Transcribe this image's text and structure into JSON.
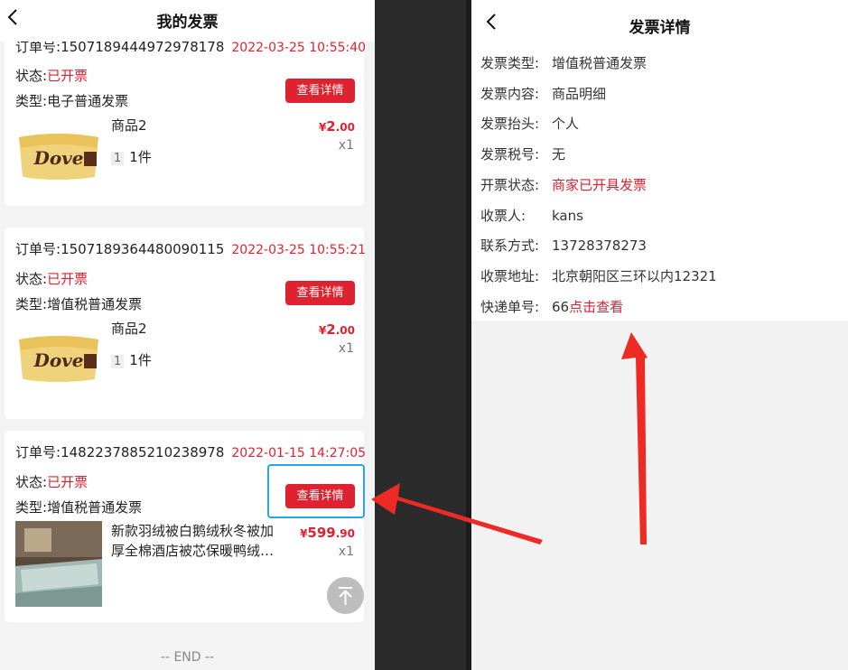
{
  "left": {
    "title": "我的发票",
    "back_glyph": "<",
    "orders": [
      {
        "order_label": "订单号:",
        "order_no": "1507189444972978178",
        "datetime": "2022-03-25 10:55:40",
        "status_label": "状态:",
        "status_value": "已开票",
        "type_label": "类型:",
        "type_value": "电子普通发票",
        "button": "查看详情",
        "product_name": "商品2",
        "qty_badge": "1",
        "qty_text": "1件",
        "price_symbol": "¥",
        "price_int": "2",
        "price_dec": ".00",
        "count": "x1"
      },
      {
        "order_label": "订单号:",
        "order_no": "1507189364480090115",
        "datetime": "2022-03-25 10:55:21",
        "status_label": "状态:",
        "status_value": "已开票",
        "type_label": "类型:",
        "type_value": "增值税普通发票",
        "button": "查看详情",
        "product_name": "商品2",
        "qty_badge": "1",
        "qty_text": "1件",
        "price_symbol": "¥",
        "price_int": "2",
        "price_dec": ".00",
        "count": "x1"
      },
      {
        "order_label": "订单号:",
        "order_no": "1482237885210238978",
        "datetime": "2022-01-15 14:27:05",
        "status_label": "状态:",
        "status_value": "已开票",
        "type_label": "类型:",
        "type_value": "增值税普通发票",
        "button": "查看详情",
        "product_name_line1": "新款羽绒被白鹅绒秋冬被加",
        "product_name_line2": "厚全棉酒店被芯保暖鸭绒…",
        "price_symbol": "¥",
        "price_int": "599",
        "price_dec": ".90",
        "count": "x1"
      }
    ],
    "end_text": "-- END --"
  },
  "right": {
    "title": "发票详情",
    "back_glyph": "<",
    "rows": [
      {
        "label": "发票类型:",
        "value": "增值税普通发票"
      },
      {
        "label": "发票内容:",
        "value": "商品明细"
      },
      {
        "label": "发票抬头:",
        "value": "个人"
      },
      {
        "label": "发票税号:",
        "value": "无"
      },
      {
        "label": "开票状态:",
        "value": "商家已开具发票"
      },
      {
        "label": "收票人:",
        "value": "kans"
      },
      {
        "label": "联系方式:",
        "value": "13728378273"
      },
      {
        "label": "收票地址:",
        "value": "北京朝阳区三环以内12321"
      },
      {
        "label": "快递单号:",
        "value": "66",
        "link": "点击查看"
      }
    ]
  },
  "colors": {
    "accent_red": "#e0212f",
    "highlight_blue": "#2aa6e0",
    "arrow_red": "#ee2a24"
  },
  "icons": {
    "back": "chevron-left-icon",
    "to_top": "arrow-up-to-top-icon"
  }
}
